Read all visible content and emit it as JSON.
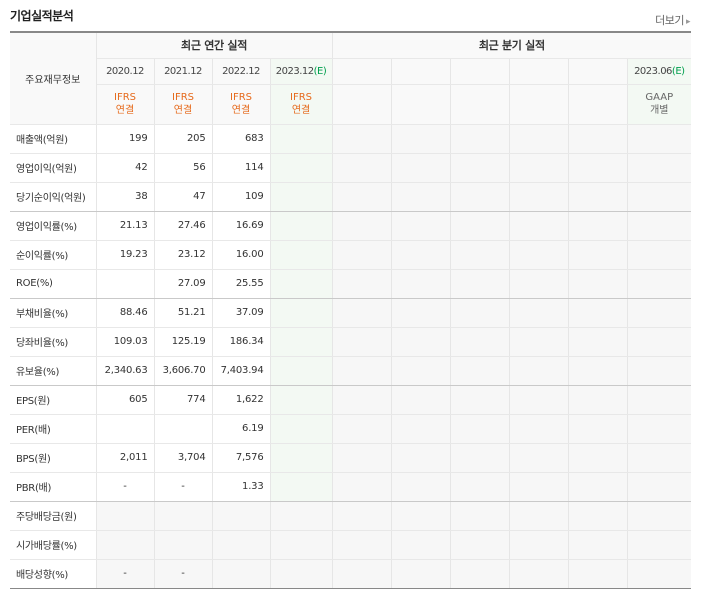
{
  "header": {
    "title": "기업실적분석",
    "more": "더보기"
  },
  "table": {
    "row_header": "주요재무정보",
    "annual_title": "최근 연간 실적",
    "quarter_title": "최근 분기 실적",
    "years": [
      "2020.12",
      "2021.12",
      "2022.12",
      "2023.12"
    ],
    "est_year_mark": "(E)",
    "quarter_est": "2023.06",
    "types": [
      "IFRS",
      "IFRS",
      "IFRS",
      "IFRS"
    ],
    "type_subs": [
      "연결",
      "연결",
      "연결",
      "연결"
    ],
    "quarter_type": "GAAP",
    "quarter_type_sub": "개별",
    "rows": [
      {
        "label": "매출액(억원)",
        "values": [
          "199",
          "205",
          "683",
          ""
        ]
      },
      {
        "label": "영업이익(억원)",
        "values": [
          "42",
          "56",
          "114",
          ""
        ]
      },
      {
        "label": "당기순이익(억원)",
        "values": [
          "38",
          "47",
          "109",
          ""
        ]
      },
      {
        "label": "영업이익률(%)",
        "values": [
          "21.13",
          "27.46",
          "16.69",
          ""
        ]
      },
      {
        "label": "순이익률(%)",
        "values": [
          "19.23",
          "23.12",
          "16.00",
          ""
        ]
      },
      {
        "label": "ROE(%)",
        "values": [
          "",
          "27.09",
          "25.55",
          ""
        ]
      },
      {
        "label": "부채비율(%)",
        "values": [
          "88.46",
          "51.21",
          "37.09",
          ""
        ]
      },
      {
        "label": "당좌비율(%)",
        "values": [
          "109.03",
          "125.19",
          "186.34",
          ""
        ]
      },
      {
        "label": "유보율(%)",
        "values": [
          "2,340.63",
          "3,606.70",
          "7,403.94",
          ""
        ]
      },
      {
        "label": "EPS(원)",
        "values": [
          "605",
          "774",
          "1,622",
          ""
        ]
      },
      {
        "label": "PER(배)",
        "values": [
          "",
          "",
          "6.19",
          ""
        ]
      },
      {
        "label": "BPS(원)",
        "values": [
          "2,011",
          "3,704",
          "7,576",
          ""
        ]
      },
      {
        "label": "PBR(배)",
        "values": [
          "-",
          "-",
          "1.33",
          ""
        ]
      },
      {
        "label": "주당배당금(원)",
        "values": [
          "",
          "",
          "",
          ""
        ]
      },
      {
        "label": "시가배당률(%)",
        "values": [
          "",
          "",
          "",
          ""
        ]
      },
      {
        "label": "배당성향(%)",
        "values": [
          "-",
          "-",
          "",
          ""
        ]
      }
    ]
  }
}
